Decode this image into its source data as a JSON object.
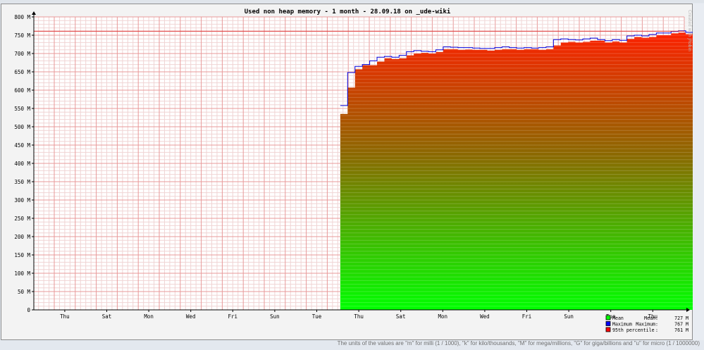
{
  "footnote": "The units of the values are \"m\" for milli (1 / 1000), \"k\" for kilo/thousands, \"M\" for mega/millions, \"G\" for giga/billions and \"u\" for micro (1 / 1000000)",
  "watermark": "Created with JRobin",
  "chart_data": {
    "type": "area",
    "title": "Used non heap memory - 1 month - 28.09.18 on _ude-wiki",
    "xlabel": "",
    "ylabel": "",
    "ylim": [
      0,
      800
    ],
    "yticks": [
      "0",
      "50 M",
      "100 M",
      "150 M",
      "200 M",
      "250 M",
      "300 M",
      "350 M",
      "400 M",
      "450 M",
      "500 M",
      "550 M",
      "600 M",
      "650 M",
      "700 M",
      "750 M",
      "800 M"
    ],
    "xticks": [
      "Thu",
      "Sat",
      "Mon",
      "Wed",
      "Fri",
      "Sun",
      "Tue",
      "Thu",
      "Sat",
      "Mon",
      "Wed",
      "Fri",
      "Sun",
      "Tue",
      "Thu"
    ],
    "xlim_days": [
      0,
      31
    ],
    "hline_95th": 761,
    "grid": true,
    "legend_position": "bottom-right",
    "legend": [
      {
        "name": "Mean",
        "label": "Mean:",
        "value": "727 M",
        "color": "#00ff00"
      },
      {
        "name": "Maximum",
        "label": "Maximum:",
        "value": "767 M",
        "color": "#0000ff"
      },
      {
        "name": "95th percentile",
        "label": ":",
        "value": "761 M",
        "color": "#ff0000"
      }
    ],
    "series": [
      {
        "name": "Mean",
        "start_day": 13.62,
        "step_days": 0.35,
        "values": [
          535,
          607,
          657,
          668,
          668,
          678,
          687,
          685,
          687,
          695,
          700,
          702,
          700,
          704,
          712,
          712,
          710,
          711,
          710,
          710,
          708,
          710,
          712,
          712,
          710,
          712,
          712,
          710,
          712,
          722,
          730,
          732,
          730,
          732,
          735,
          735,
          730,
          733,
          730,
          740,
          745,
          743,
          745,
          750,
          750,
          755,
          757,
          753,
          755,
          752,
          752,
          748,
          745,
          742,
          743,
          748,
          755,
          757,
          757,
          760,
          757,
          756,
          757,
          758,
          755,
          760,
          762,
          760,
          762,
          763,
          760
        ]
      },
      {
        "name": "Maximum",
        "start_day": 13.62,
        "step_days": 0.35,
        "values": [
          558,
          648,
          665,
          670,
          680,
          690,
          692,
          690,
          695,
          705,
          708,
          706,
          705,
          710,
          718,
          717,
          716,
          716,
          715,
          714,
          714,
          716,
          718,
          716,
          715,
          716,
          715,
          716,
          718,
          738,
          740,
          738,
          737,
          740,
          742,
          738,
          735,
          738,
          736,
          748,
          750,
          748,
          752,
          756,
          756,
          760,
          762,
          758,
          760,
          758,
          756,
          752,
          750,
          748,
          750,
          755,
          760,
          762,
          762,
          765,
          762,
          760,
          762,
          764,
          760,
          765,
          767,
          765,
          766,
          767,
          765
        ]
      }
    ]
  }
}
